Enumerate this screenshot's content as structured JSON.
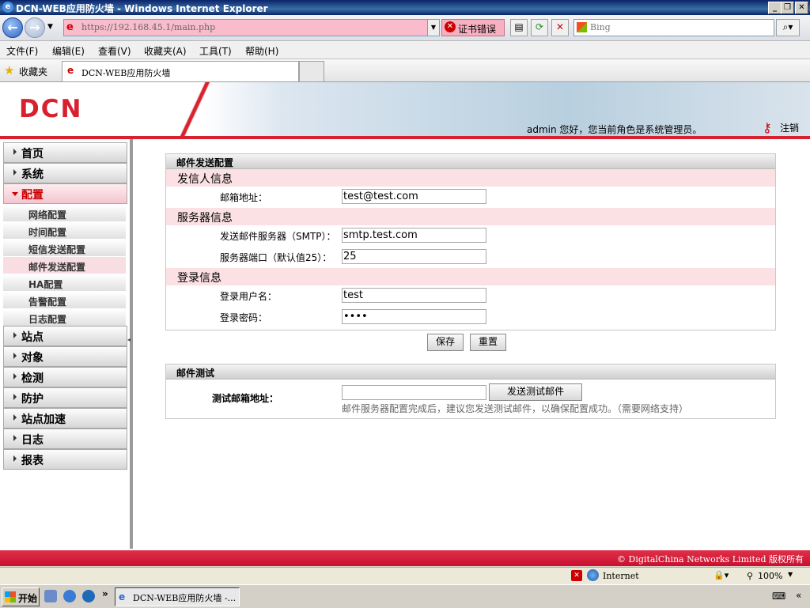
{
  "window": {
    "title": "DCN-WEB应用防火墙 - Windows Internet Explorer"
  },
  "browser": {
    "address": "https://192.168.45.1/main.php",
    "cert_error": "证书错误",
    "search_placeholder": "Bing",
    "menu": [
      "文件(F)",
      "编辑(E)",
      "查看(V)",
      "收藏夹(A)",
      "工具(T)",
      "帮助(H)"
    ],
    "favorites_label": "收藏夹",
    "tab_title": "DCN-WEB应用防火墙",
    "status_zone": "Internet",
    "zoom": "100%"
  },
  "header": {
    "logo": "DCN",
    "welcome": "admin 您好，您当前角色是系统管理员。",
    "logout": "注销"
  },
  "sidebar": {
    "top1": [
      "首页",
      "系统",
      "配置"
    ],
    "sub": [
      "网络配置",
      "时间配置",
      "短信发送配置",
      "邮件发送配置",
      "HA配置",
      "告警配置",
      "日志配置"
    ],
    "top2": [
      "站点",
      "对象",
      "检测",
      "防护",
      "站点加速",
      "日志",
      "报表"
    ]
  },
  "mail_config": {
    "title": "邮件发送配置",
    "sender_section": "发信人信息",
    "email_label": "邮箱地址：",
    "email_value": "test@test.com",
    "server_section": "服务器信息",
    "smtp_label": "发送邮件服务器（SMTP）：",
    "smtp_value": "smtp.test.com",
    "port_label": "服务器端口（默认值25）：",
    "port_value": "25",
    "login_section": "登录信息",
    "username_label": "登录用户名：",
    "username_value": "test",
    "password_label": "登录密码：",
    "password_value": "test",
    "save": "保存",
    "reset": "重置"
  },
  "mail_test": {
    "title": "邮件测试",
    "label": "测试邮箱地址：",
    "value": "",
    "send_button": "发送测试邮件",
    "hint": "邮件服务器配置完成后，建议您发送测试邮件，以确保配置成功。（需要网络支持）"
  },
  "footer": {
    "copyright": "© DigitalChina Networks Limited 版权所有"
  },
  "taskbar": {
    "start": "开始",
    "item": "DCN-WEB应用防火墙 -..."
  }
}
